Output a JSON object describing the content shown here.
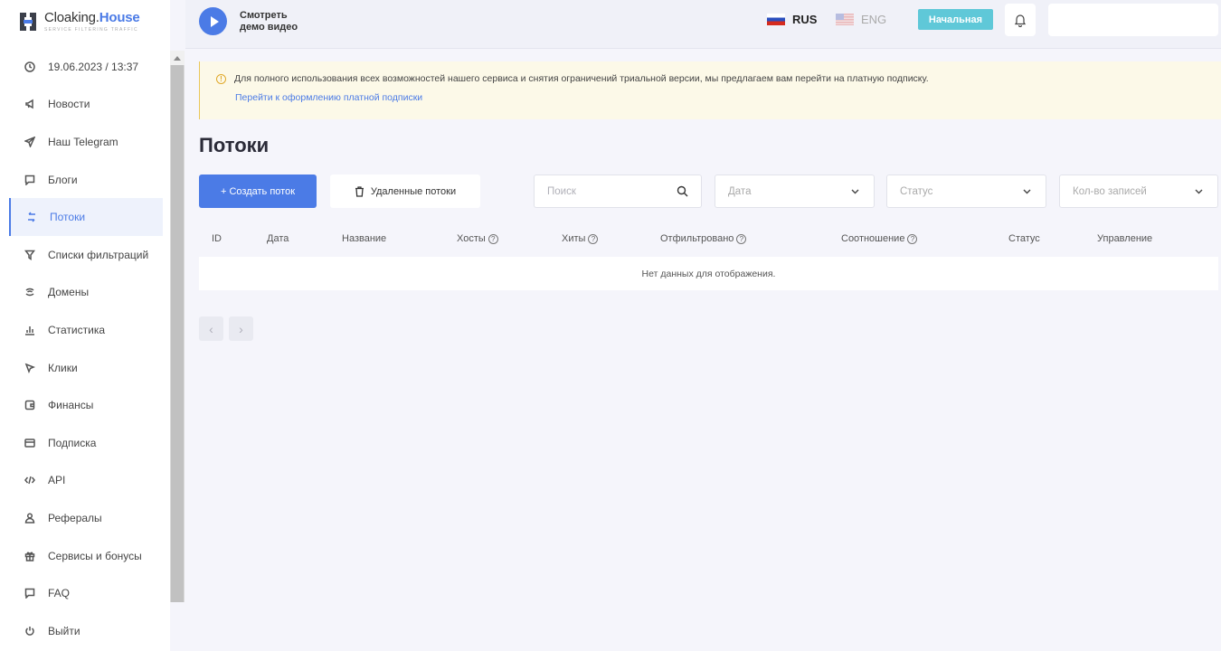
{
  "logo": {
    "name_main": "Cloaking.",
    "name_brand": "House",
    "tagline": "SERVICE FILTERING TRAFFIC"
  },
  "sidebar": {
    "items": [
      {
        "label": "19.06.2023 / 13:37",
        "icon": "clock-icon"
      },
      {
        "label": "Новости",
        "icon": "megaphone-icon"
      },
      {
        "label": "Наш Telegram",
        "icon": "telegram-icon"
      },
      {
        "label": "Блоги",
        "icon": "chat-icon"
      },
      {
        "label": "Потоки",
        "icon": "flows-icon",
        "active": true
      },
      {
        "label": "Списки фильтраций",
        "icon": "filter-icon"
      },
      {
        "label": "Домены",
        "icon": "wifi-icon"
      },
      {
        "label": "Статистика",
        "icon": "chart-icon"
      },
      {
        "label": "Клики",
        "icon": "cursor-icon"
      },
      {
        "label": "Финансы",
        "icon": "wallet-icon"
      },
      {
        "label": "Подписка",
        "icon": "card-icon"
      },
      {
        "label": "API",
        "icon": "code-icon"
      },
      {
        "label": "Рефералы",
        "icon": "user-icon"
      },
      {
        "label": "Сервисы и бонусы",
        "icon": "gift-icon"
      },
      {
        "label": "FAQ",
        "icon": "chat-icon"
      },
      {
        "label": "Выйти",
        "icon": "power-icon"
      }
    ]
  },
  "header": {
    "demo_line1": "Смотреть",
    "demo_line2": "демо видео",
    "lang_ru": "RUS",
    "lang_en": "ENG",
    "plan_badge": "Начальная"
  },
  "notice": {
    "text": "Для полного использования всех возможностей нашего сервиса и снятия ограничений триальной версии, мы предлагаем вам перейти на платную подписку.",
    "link": "Перейти к оформлению платной подписки"
  },
  "main": {
    "title": "Потоки",
    "create_button": "+ Создать поток",
    "deleted_button": "Удаленные потоки",
    "search_placeholder": "Поиск",
    "date_placeholder": "Дата",
    "status_placeholder": "Статус",
    "count_placeholder": "Кол-во записей"
  },
  "table": {
    "columns": [
      "ID",
      "Дата",
      "Название",
      "Хосты",
      "Хиты",
      "Отфильтровано",
      "Соотношение",
      "Статус",
      "Управление"
    ],
    "empty": "Нет данных для отображения."
  },
  "colors": {
    "accent": "#4b7be6",
    "badge": "#5fc8d8",
    "warning": "#e0a92a"
  }
}
